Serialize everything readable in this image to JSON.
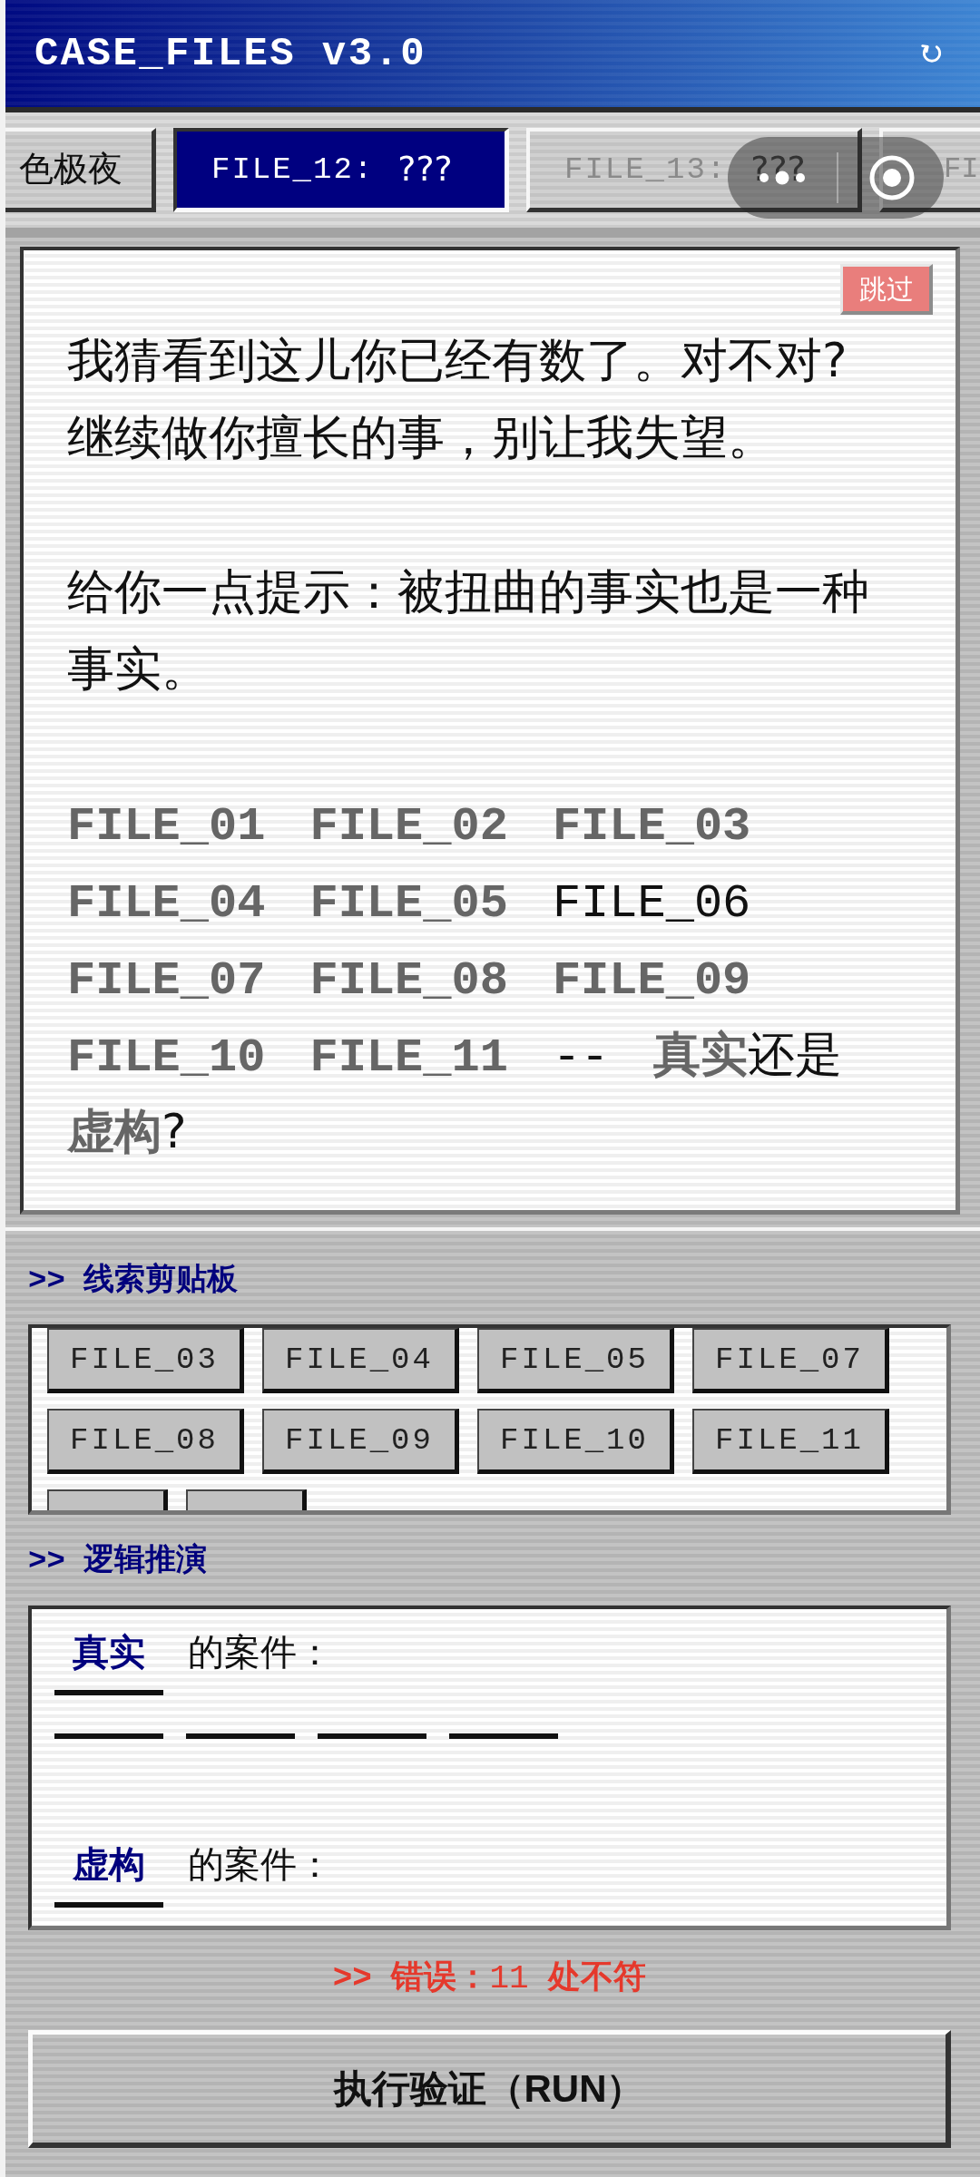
{
  "header": {
    "title": "CASE_FILES v3.0"
  },
  "tabs": [
    {
      "title": "色极夜",
      "selected": false,
      "disabled": false
    },
    {
      "code": "FILE_12:",
      "title": "???",
      "selected": true,
      "disabled": false
    },
    {
      "code": "FILE_13:",
      "title": "???",
      "selected": false,
      "disabled": true
    },
    {
      "code": "FI",
      "selected": false,
      "disabled": true
    }
  ],
  "message": {
    "skip_button": "跳过",
    "paragraphs": [
      [
        "我猜看到这儿你已经有数了。对不对?",
        "继续做你擅长的事，别让我失望。"
      ],
      [
        "给你一点提示：被扭曲的事实也是一种事实。"
      ]
    ],
    "clues": [
      {
        "kind": "code",
        "text": "FILE_01",
        "clue": true
      },
      {
        "kind": "code",
        "text": "FILE_02",
        "clue": true
      },
      {
        "kind": "code",
        "text": "FILE_03",
        "clue": true
      },
      {
        "kind": "code",
        "text": "FILE_04",
        "clue": true
      },
      {
        "kind": "code",
        "text": "FILE_05",
        "clue": true
      },
      {
        "kind": "code",
        "text": "FILE_06",
        "clue": false
      },
      {
        "kind": "code",
        "text": "FILE_07",
        "clue": true
      },
      {
        "kind": "code",
        "text": "FILE_08",
        "clue": true
      },
      {
        "kind": "code",
        "text": "FILE_09",
        "clue": true
      },
      {
        "kind": "code",
        "text": "FILE_10",
        "clue": true
      },
      {
        "kind": "code",
        "text": "FILE_11",
        "clue": true
      },
      {
        "kind": "code",
        "text": "--",
        "clue": false
      },
      {
        "kind": "word",
        "text": "真实",
        "clue": true
      },
      {
        "kind": "word",
        "text": "还是",
        "clue": false
      },
      {
        "kind": "word",
        "text": "虚构",
        "clue": true
      },
      {
        "kind": "word",
        "text": "?",
        "clue": false
      }
    ]
  },
  "clipboard": {
    "heading": ">> 线索剪贴板",
    "chips": [
      {
        "kind": "chip",
        "label": "FILE_03"
      },
      {
        "kind": "chip",
        "label": "FILE_04"
      },
      {
        "kind": "chip",
        "label": "FILE_05"
      },
      {
        "kind": "chip",
        "label": "FILE_07"
      },
      {
        "kind": "chip",
        "label": "FILE_08"
      },
      {
        "kind": "chip",
        "label": "FILE_09"
      },
      {
        "kind": "chip",
        "label": "FILE_10"
      },
      {
        "kind": "chip",
        "label": "FILE_11"
      },
      {
        "kind": "cut"
      },
      {
        "kind": "cut"
      }
    ]
  },
  "deduction": {
    "heading": ">> 逻辑推演",
    "groups": [
      {
        "label": "真实",
        "suffix": "的案件：",
        "slots": [
          {
            "kind": "blank"
          },
          {
            "kind": "blank"
          },
          {
            "kind": "blank"
          },
          {
            "kind": "blank"
          }
        ]
      },
      {
        "label": "虚构",
        "suffix": "的案件："
      }
    ]
  },
  "error": "**>> 错误：**11 **处不符**",
  "run_button": "执行验证（RUN）"
}
